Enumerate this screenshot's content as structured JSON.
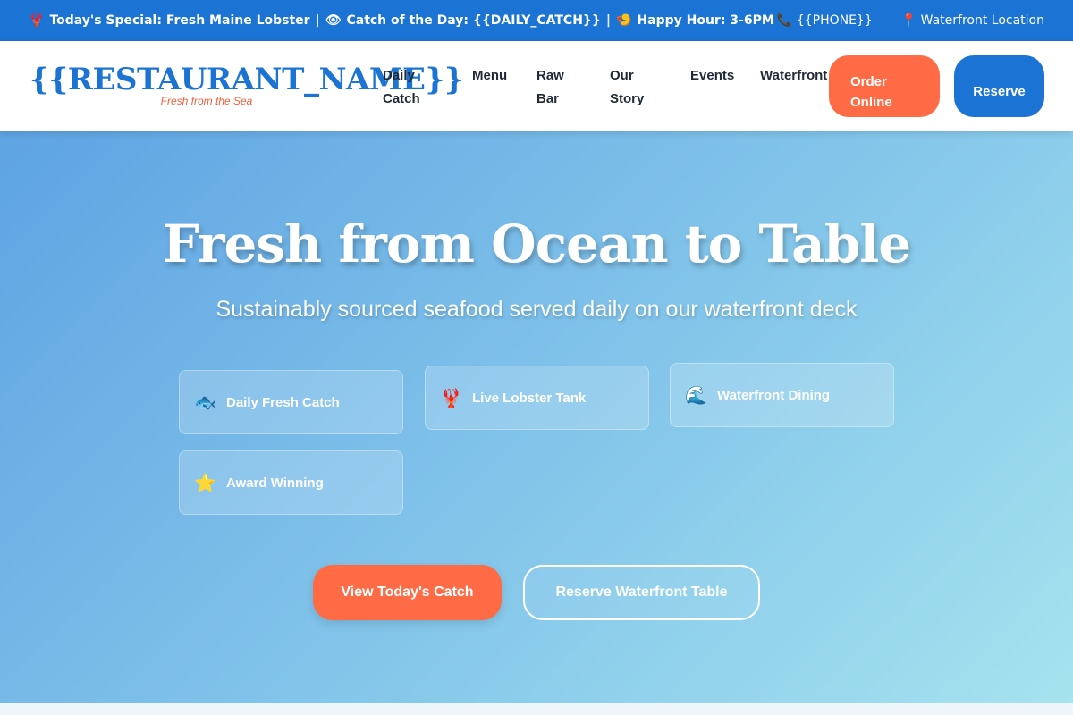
{
  "topbar": {
    "special_icon": "lobster-emoji",
    "special_emoji": "🦞",
    "special_text": "Today's Special: Fresh Maine Lobster",
    "separator": "|",
    "catch_icon": "eye-emoji",
    "catch_emoji": "👁",
    "catch_text": "Catch of the Day: {{DAILY_CATCH}}",
    "happy_icon": "shrimp-emoji",
    "happy_emoji": "🍤",
    "happy_text": "Happy Hour: 3-6PM",
    "phone_icon": "phone-icon",
    "phone_emoji": "📞",
    "phone_text": "{{PHONE}}",
    "location_icon": "pin-icon",
    "location_emoji": "📍",
    "location_text": "Waterfront Location"
  },
  "header": {
    "brand_name": "{{RESTAURANT_NAME}}",
    "brand_tagline": "Fresh from the Sea",
    "nav": [
      {
        "label_line1": "Daily",
        "label_line2": "Catch"
      },
      {
        "label_line1": "Menu",
        "label_line2": ""
      },
      {
        "label_line1": "Raw",
        "label_line2": "Bar"
      },
      {
        "label_line1": "Our",
        "label_line2": "Story"
      },
      {
        "label_line1": "Events",
        "label_line2": ""
      },
      {
        "label_line1": "Waterfront",
        "label_line2": ""
      }
    ],
    "order_line1": "Order",
    "order_line2": "Online",
    "reserve_label": "Reserve"
  },
  "hero": {
    "title": "Fresh from Ocean to Table",
    "subtitle": "Sustainably sourced seafood served daily on our waterfront deck",
    "features": [
      {
        "icon": "fish-icon",
        "emoji": "🐟",
        "label": "Daily Fresh Catch"
      },
      {
        "icon": "lobster-icon",
        "emoji": "🦞",
        "label": "Live Lobster Tank"
      },
      {
        "icon": "wave-icon",
        "emoji": "🌊",
        "label": "Waterfront Dining"
      },
      {
        "icon": "star-icon",
        "emoji": "⭐",
        "label": "Award Winning"
      }
    ],
    "cta_primary": "View Today's Catch",
    "cta_secondary": "Reserve Waterfront Table"
  },
  "colors": {
    "primary_blue": "#1b74d4",
    "accent_orange": "#ff6b45"
  }
}
